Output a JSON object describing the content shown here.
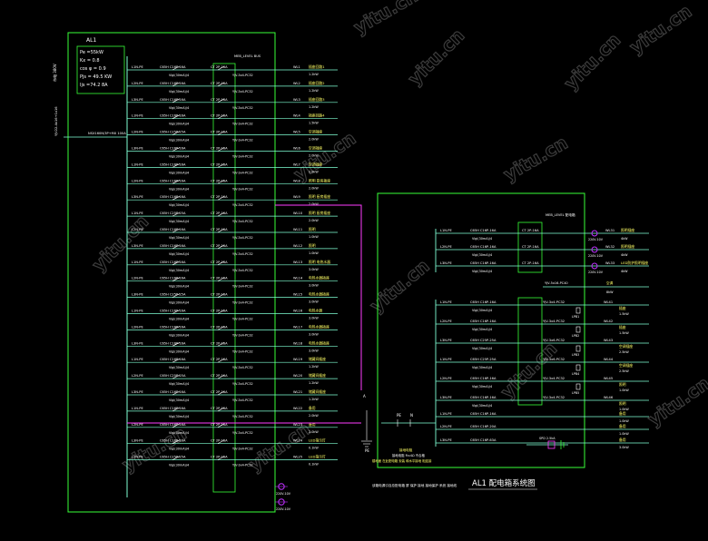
{
  "colors": {
    "background": "#000000",
    "frame": "#39ff39",
    "branch": "#7fffd4",
    "label": "#ffffff",
    "label_alt": "#ffff66",
    "bus": "#ff3cff",
    "meter": "#c030ff",
    "watermark": "#3c3c3c"
  },
  "watermark": "yitu.cn",
  "left_panel": {
    "title": "AL1",
    "params": [
      "Pe =55kW",
      "Kx = 0.8",
      "cos φ = 0.9",
      "Pjs = 49.5 KW",
      "Ijs =74.2 8A"
    ],
    "incoming_vertical": "YJV22-4x16+1x16",
    "incoming_breaker": "NSX160N/3P+MX 100A",
    "side_label": "市电\n380V",
    "bus_label": "MEB_LEVEL BUS",
    "breaker": "C65H C16P-16A",
    "breaker_alt": "C65H C25P-25A",
    "rcd": "Vigi(30mA)/4",
    "contactor": "CT 2P-16A",
    "cable": "YJV-3x4-PC32",
    "rows": [
      {
        "line": "L1N-PE",
        "circuit": "WL1",
        "load": "插座回路1",
        "power": "1.2kW"
      },
      {
        "line": "L2N-PE",
        "circuit": "WL2",
        "load": "插座回路2",
        "power": "1.2kW"
      },
      {
        "line": "L3N-PE",
        "circuit": "WL3",
        "load": "插座回路3",
        "power": "1.2kW"
      },
      {
        "line": "L1N-PE",
        "circuit": "WL4",
        "load": "插座回路4",
        "power": "1.5kW"
      },
      {
        "line": "L2N-PE",
        "circuit": "WL5",
        "load": "空调插座",
        "power": "2.0kW"
      },
      {
        "line": "L3N-PE",
        "circuit": "WL6",
        "load": "空调插座",
        "power": "2.0kW"
      },
      {
        "line": "L1N-PE",
        "circuit": "WL7",
        "load": "空调插座",
        "power": "2.0kW"
      },
      {
        "line": "L2N-PE",
        "circuit": "WL8",
        "load": "照明 厨房插座",
        "power": "2.0kW"
      },
      {
        "line": "L3N-PE",
        "circuit": "WL9",
        "load": "照明 厨房插座",
        "power": "2.0kW"
      },
      {
        "line": "L1N-PE",
        "circuit": "WL10",
        "load": "照明 厨房插座",
        "power": "2.0kW"
      },
      {
        "line": "L2N-PE",
        "circuit": "WL11",
        "load": "照明",
        "power": "1.0kW"
      },
      {
        "line": "L3N-PE",
        "circuit": "WL12",
        "load": "照明",
        "power": "1.0kW"
      },
      {
        "line": "L1N-PE",
        "circuit": "WL13",
        "load": "照明 电热水器",
        "power": "3.0kW"
      },
      {
        "line": "L2N-PE",
        "circuit": "WL14",
        "load": "电热水器插座",
        "power": "3.0kW"
      },
      {
        "line": "L3N-PE",
        "circuit": "WL15",
        "load": "电热水器插座",
        "power": "3.0kW"
      },
      {
        "line": "L1N-PE",
        "circuit": "WL16",
        "load": "电热水器",
        "power": "3.0kW"
      },
      {
        "line": "L2N-PE",
        "circuit": "WL17",
        "load": "电热水器插座",
        "power": "3.0kW"
      },
      {
        "line": "L3N-PE",
        "circuit": "WL18",
        "load": "电热水器插座",
        "power": "3.0kW"
      },
      {
        "line": "L1N-PE",
        "circuit": "WL19",
        "load": "储藏间插座",
        "power": "1.2kW"
      },
      {
        "line": "L2N-PE",
        "circuit": "WL20",
        "load": "储藏间插座",
        "power": "1.2kW"
      },
      {
        "line": "L3N-PE",
        "circuit": "WL21",
        "load": "储藏间插座",
        "power": "1.2kW"
      },
      {
        "line": "L1N-PE",
        "circuit": "WL22",
        "load": "备用",
        "power": "2.0kW"
      },
      {
        "line": "L2N-PE",
        "circuit": "WL23",
        "load": "备用",
        "power": "2.0kW"
      },
      {
        "line": "L3N-PE",
        "circuit": "WL24",
        "load": "LED指示灯",
        "power": "0.1kW"
      },
      {
        "line": "L1N-PE",
        "circuit": "WL25",
        "load": "LED指示灯",
        "power": "0.1kW"
      }
    ],
    "meter_top": "220V-10V",
    "meter_bottom": "220V-10V"
  },
  "right_panel": {
    "top_label": "MEB_LEVEL 配电箱",
    "upper_rows": [
      {
        "line": "L1N-PE",
        "breaker": "C65H C16P-16A",
        "contactor": "CT 2P-16A",
        "meter": "220V-10V",
        "circuit": "WL31",
        "load": "照明插座"
      },
      {
        "line": "L2N-PE",
        "breaker": "C65H C16P-16A",
        "contactor": "CT 2P-16A",
        "meter": "220V-10V",
        "circuit": "WL32",
        "load": "照明插座"
      },
      {
        "line": "L3N-PE",
        "breaker": "C65H C16P-16A",
        "contactor": "CT 2P-16A",
        "meter": "220V-10V",
        "circuit": "WL33",
        "load": "LED防护照明插座"
      }
    ],
    "upper_powers": [
      "4kW",
      "4kW",
      "4kW"
    ],
    "feeder_note": "YJV-5x16-PC40",
    "feeder_load": "空调",
    "feeder_power": "8kW",
    "lower_rows": [
      {
        "line": "L1N-PE",
        "breaker": "C65H C16P-16A",
        "cable": "YJV-3x4-PC32",
        "circuit": "WL41",
        "load": "插座",
        "power": "1.5kW"
      },
      {
        "line": "L2N-PE",
        "breaker": "C65H C16P-16A",
        "cable": "YJV-3x4-PC32",
        "circuit": "WL42",
        "load": "插座",
        "power": "1.5kW"
      },
      {
        "line": "L3N-PE",
        "breaker": "C65H C25P-25A",
        "cable": "YJV-3x6-PC32",
        "circuit": "WL43",
        "load": "空调插座",
        "power": "2.5kW"
      },
      {
        "line": "L1N-PE",
        "breaker": "C65H C25P-25A",
        "cable": "YJV-3x6-PC32",
        "circuit": "WL44",
        "load": "空调插座",
        "power": "2.5kW"
      },
      {
        "line": "L2N-PE",
        "breaker": "C65H C16P-16A",
        "cable": "YJV-3x4-PC32",
        "circuit": "WL45",
        "load": "照明",
        "power": "1.0kW"
      },
      {
        "line": "L3N-PE",
        "breaker": "C65H C16P-16A",
        "cable": "YJV-3x4-PC32",
        "circuit": "WL46",
        "load": "照明",
        "power": "1.0kW"
      }
    ],
    "rcd": "Vigi(30mA)/4",
    "meter_tags": [
      "LPB1",
      "LPB2",
      "LPB3",
      "LPB4",
      "LPB5"
    ],
    "spare_rows": [
      {
        "line": "L1N-PE",
        "breaker": "C65H C16P-16A",
        "load": "备用",
        "power": "1.0kW"
      },
      {
        "line": "L2N-PE",
        "breaker": "C65H C16P-20A",
        "load": "备用",
        "power": "1.0kW"
      },
      {
        "line": "L3N-PE",
        "breaker": "C65H C16P-63A",
        "load": "备用",
        "power": "3.0kW"
      }
    ],
    "spd_label": "SPD 2.5kA",
    "pe_label": "PE",
    "n_label": "N",
    "pe_bottom": "PE",
    "ground_label": "A",
    "note_title": "接地电阻",
    "note_lines": [
      "接地电阻 R≤4Ω 不合格",
      "楼地面 在此配电箱 安装 和水平接地 相连接"
    ],
    "bottom_note": "该箱电源引自总配电箱 屏 保护 接地 接地保护 系统 接地线",
    "diagram_title": "AL1  配电箱系统图"
  }
}
